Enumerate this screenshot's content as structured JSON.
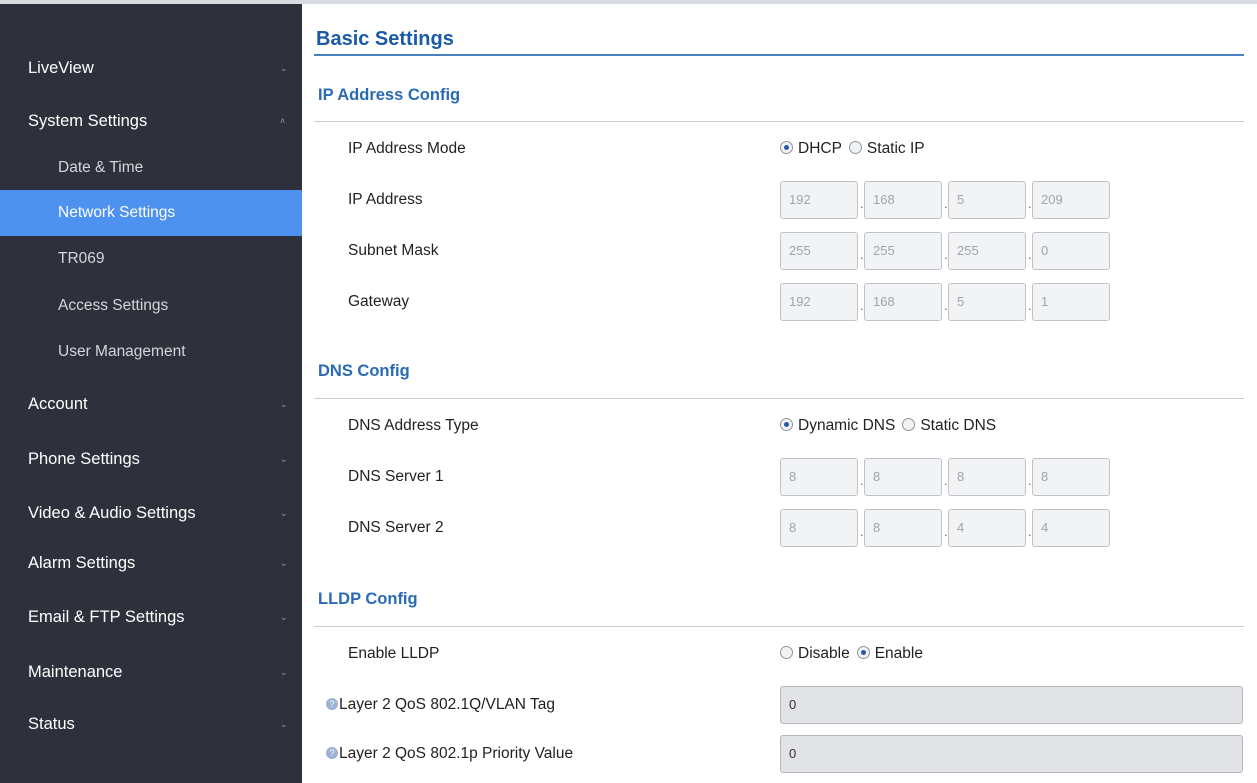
{
  "sidebar": {
    "items": [
      {
        "label": "LiveView",
        "chevron": "⌄"
      },
      {
        "label": "System Settings",
        "chevron": "˄"
      },
      {
        "label": "Date & Time"
      },
      {
        "label": "Network Settings"
      },
      {
        "label": "TR069"
      },
      {
        "label": "Access Settings"
      },
      {
        "label": "User Management"
      },
      {
        "label": "Account",
        "chevron": "⌄"
      },
      {
        "label": "Phone Settings",
        "chevron": "⌄"
      },
      {
        "label": "Video & Audio Settings",
        "chevron": "⌄"
      },
      {
        "label": "Alarm Settings",
        "chevron": "⌄"
      },
      {
        "label": "Email & FTP Settings",
        "chevron": "⌄"
      },
      {
        "label": "Maintenance",
        "chevron": "⌄"
      },
      {
        "label": "Status",
        "chevron": "⌄"
      }
    ],
    "active_item": "Network Settings"
  },
  "main": {
    "title": "Basic Settings",
    "ip_config": {
      "title": "IP Address Config",
      "mode_label": "IP Address Mode",
      "mode_options": [
        "DHCP",
        "Static IP"
      ],
      "mode_selected": "DHCP",
      "ip_label": "IP Address",
      "ip": [
        "192",
        "168",
        "5",
        "209"
      ],
      "subnet_label": "Subnet Mask",
      "subnet": [
        "255",
        "255",
        "255",
        "0"
      ],
      "gateway_label": "Gateway",
      "gateway": [
        "192",
        "168",
        "5",
        "1"
      ]
    },
    "dns_config": {
      "title": "DNS Config",
      "type_label": "DNS Address Type",
      "type_options": [
        "Dynamic DNS",
        "Static DNS"
      ],
      "type_selected": "Dynamic DNS",
      "server1_label": "DNS Server 1",
      "server1": [
        "8",
        "8",
        "8",
        "8"
      ],
      "server2_label": "DNS Server 2",
      "server2": [
        "8",
        "8",
        "4",
        "4"
      ]
    },
    "lldp_config": {
      "title": "LLDP Config",
      "enable_label": "Enable LLDP",
      "enable_options": [
        "Disable",
        "Enable"
      ],
      "enable_selected": "Enable",
      "vlan_label": "Layer 2 QoS 802.1Q/VLAN Tag",
      "vlan_value": "0",
      "priority_label": "Layer 2 QoS 802.1p Priority Value",
      "priority_value": "0"
    }
  },
  "colors": {
    "sidebar_bg": "#2e313b",
    "sidebar_active": "#4d92ee",
    "title_blue": "#1a5aa8",
    "section_blue": "#2a6bb5"
  }
}
